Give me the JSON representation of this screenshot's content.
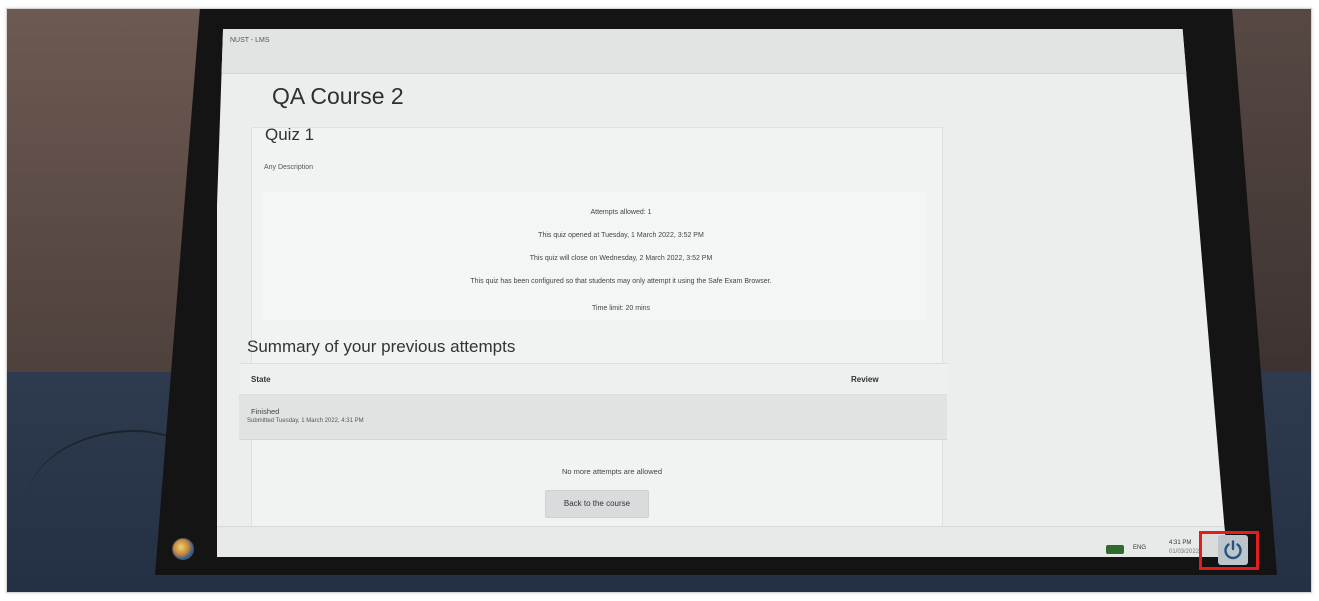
{
  "window": {
    "brand": "NUST - LMS"
  },
  "course": {
    "title": "QA Course 2"
  },
  "quiz": {
    "title": "Quiz 1",
    "description": "Any Description",
    "info": [
      "Attempts allowed: 1",
      "This quiz opened at Tuesday, 1 March 2022, 3:52 PM",
      "This quiz will close on Wednesday, 2 March 2022, 3:52 PM",
      "This quiz has been configured so that students may only attempt it using the Safe Exam Browser.",
      "Time limit: 20 mins"
    ]
  },
  "summary": {
    "title": "Summary of your previous attempts",
    "headers": {
      "state": "State",
      "review": "Review"
    },
    "rows": [
      {
        "state": "Finished",
        "submitted": "Submitted Tuesday, 1 March 2022, 4:31 PM"
      }
    ],
    "no_more": "No more attempts are allowed",
    "back_button": "Back to the course"
  },
  "taskbar": {
    "language": "ENG",
    "time": "4:31 PM",
    "date": "01/03/2022",
    "start_icon": "browser-globe-icon",
    "power_icon": "power-icon",
    "highlight_color": "#e11d1d"
  }
}
